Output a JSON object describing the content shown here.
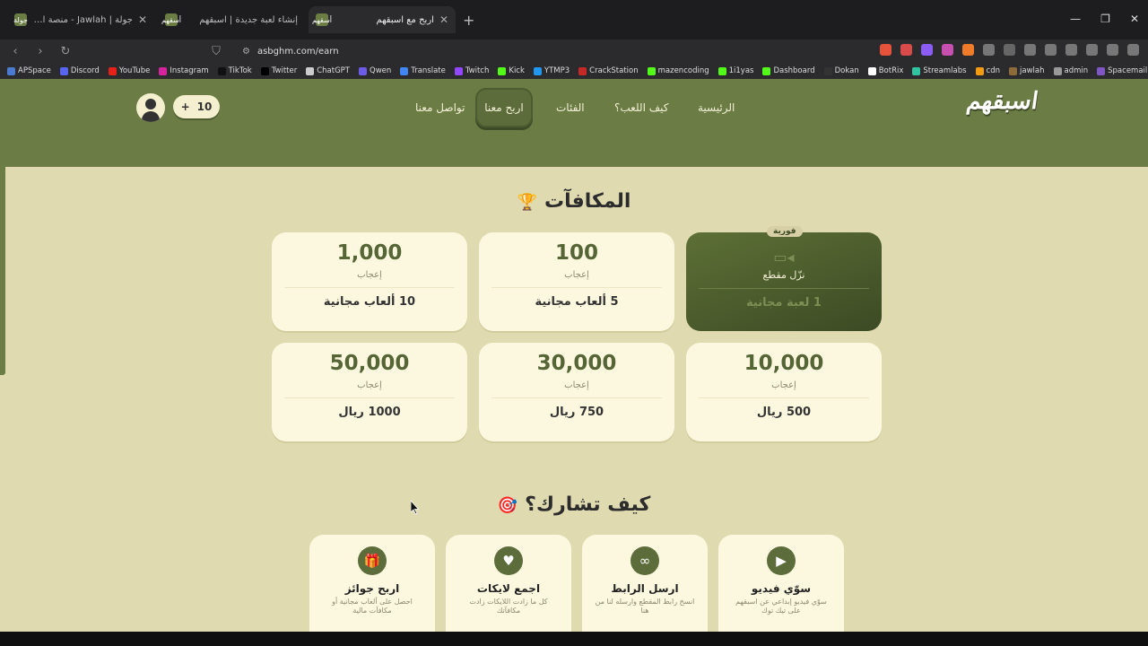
{
  "browser": {
    "tabs": [
      {
        "favicon": "جولة",
        "title": "جولة | Jawlah - منصة الألعاب التفا",
        "active": false
      },
      {
        "favicon": "أسقهم",
        "title": "إنشاء لعبة جديدة | اسبقهم",
        "active": false
      },
      {
        "favicon": "أسقهم",
        "title": "اربح مع اسبقهم",
        "active": true
      }
    ],
    "url": "asbghm.com/earn",
    "bookmarks": [
      "APSpace",
      "Discord",
      "YouTube",
      "Instagram",
      "TikTok",
      "Twitter",
      "ChatGPT",
      "Qwen",
      "Translate",
      "Twitch",
      "Kick",
      "YTMP3",
      "CrackStation",
      "mazencoding",
      "1i1yas",
      "Dashboard",
      "Dokan",
      "BotRix",
      "Streamlabs",
      "cdn",
      "jawlah",
      "admin",
      "Spacemail"
    ]
  },
  "site": {
    "logo": "اسبقهم",
    "nav": {
      "home": "الرئيسية",
      "how": "كيف اللعب؟",
      "categories": "الفئات",
      "earn": "اربح معنا",
      "contact": "تواصل معنا"
    },
    "points": "10",
    "points_plus": "+"
  },
  "rewards": {
    "title": "المكافآت",
    "title_icon": "🏆",
    "special": {
      "badge": "فورية",
      "icon": "video-camera-icon",
      "label": "نزّل مقطع",
      "prize": "1 لعبة مجانية"
    },
    "items": [
      {
        "num": "100",
        "unit": "إعجاب",
        "prize": "5 ألعاب مجانية"
      },
      {
        "num": "1,000",
        "unit": "إعجاب",
        "prize": "10 ألعاب مجانية"
      },
      {
        "num": "10,000",
        "unit": "إعجاب",
        "prize": "500 ريال"
      },
      {
        "num": "30,000",
        "unit": "إعجاب",
        "prize": "750 ريال"
      },
      {
        "num": "50,000",
        "unit": "إعجاب",
        "prize": "1000 ريال"
      }
    ]
  },
  "participate": {
    "title": "كيف تشارك؟",
    "title_icon": "🎯",
    "steps": [
      {
        "icon": "video-icon",
        "glyph": "▶",
        "title": "سوّي فيديو",
        "desc": "سوّي فيديو إبداعي عن اسبقهم على تيك توك"
      },
      {
        "icon": "link-icon",
        "glyph": "∞",
        "title": "ارسل الرابط",
        "desc": "انسخ رابط المقطع وارسله لنا من هنا"
      },
      {
        "icon": "heart-icon",
        "glyph": "♥",
        "title": "اجمع لايكات",
        "desc": "كل ما زادت اللايكات زادت مكافآتك"
      },
      {
        "icon": "gift-icon",
        "glyph": "🎁",
        "title": "اربح جوائز",
        "desc": "احصل على ألعاب مجانية أو مكافآت مالية"
      }
    ]
  },
  "colors": {
    "primary": "#6b7d45",
    "background": "#e0dab1",
    "card": "#fcf8df"
  }
}
